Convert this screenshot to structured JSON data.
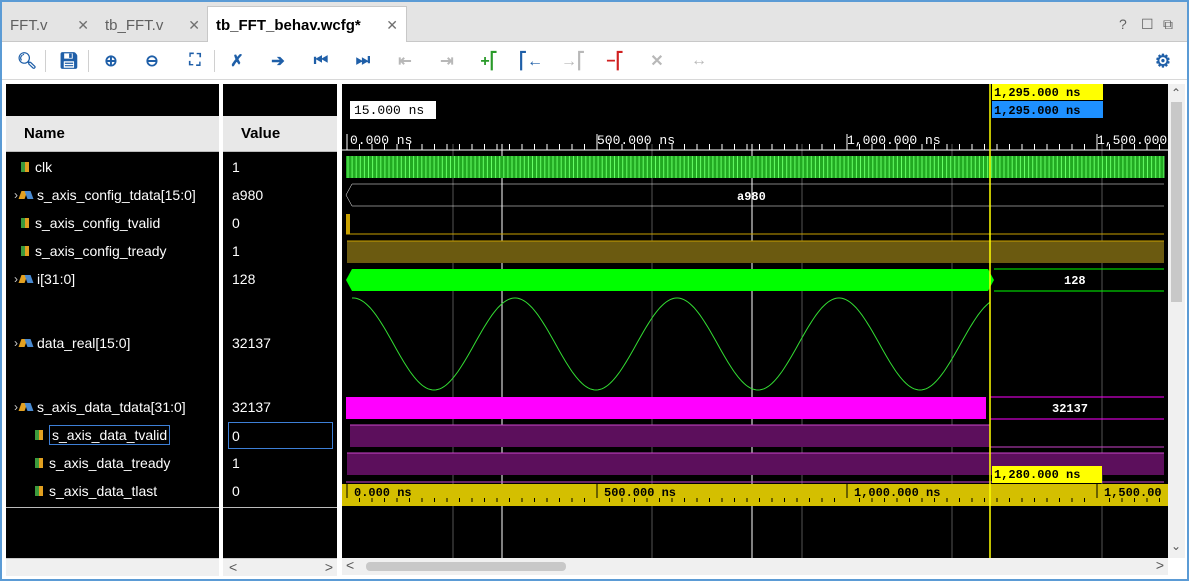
{
  "tabs": [
    {
      "label": "FFT.v",
      "active": false
    },
    {
      "label": "tb_FFT.v",
      "active": false
    },
    {
      "label": "tb_FFT_behav.wcfg*",
      "active": true
    }
  ],
  "window_controls": {
    "help": "?",
    "restore": "☐",
    "float": "⧉"
  },
  "toolbar": [
    {
      "icon": "search-icon",
      "glyph": "🔍︎"
    },
    {
      "icon": "save-icon",
      "glyph": "💾︎"
    },
    {
      "icon": "zoom-in-icon",
      "glyph": "⊕"
    },
    {
      "icon": "zoom-out-icon",
      "glyph": "⊖"
    },
    {
      "icon": "zoom-fit-icon",
      "glyph": "⛶"
    },
    {
      "icon": "cursor-snap-icon",
      "glyph": "✗"
    },
    {
      "icon": "go-to-cursor-icon",
      "glyph": "➔"
    },
    {
      "icon": "go-to-start-icon",
      "glyph": "⏮"
    },
    {
      "icon": "go-to-end-icon",
      "glyph": "⏭"
    },
    {
      "icon": "previous-transition-icon",
      "glyph": "⇤"
    },
    {
      "icon": "next-transition-icon",
      "glyph": "⇥"
    },
    {
      "icon": "add-marker-icon",
      "glyph": "+⎡"
    },
    {
      "icon": "previous-marker-icon",
      "glyph": "⎡←"
    },
    {
      "icon": "next-marker-icon",
      "glyph": "→⎡"
    },
    {
      "icon": "delete-marker-icon",
      "glyph": "−⎡"
    },
    {
      "icon": "delete-all-markers-icon",
      "glyph": "✕"
    },
    {
      "icon": "swap-cursors-icon",
      "glyph": "↔"
    }
  ],
  "settings_icon": "gear-icon",
  "columns": {
    "name": "Name",
    "value": "Value"
  },
  "signals": [
    {
      "name": "clk",
      "value": "1",
      "kind": "bit",
      "expandable": false
    },
    {
      "name": "s_axis_config_tdata[15:0]",
      "value": "a980",
      "kind": "bus",
      "expandable": true
    },
    {
      "name": "s_axis_config_tvalid",
      "value": "0",
      "kind": "bit",
      "expandable": false
    },
    {
      "name": "s_axis_config_tready",
      "value": "1",
      "kind": "bit",
      "expandable": false
    },
    {
      "name": "i[31:0]",
      "value": "128",
      "kind": "bus",
      "expandable": true
    },
    {
      "name": "data_real[15:0]",
      "value": "32137",
      "kind": "bus",
      "expandable": true
    },
    {
      "name": "s_axis_data_tdata[31:0]",
      "value": "32137",
      "kind": "bus",
      "expandable": true
    },
    {
      "name": "s_axis_data_tvalid",
      "value": "0",
      "kind": "bit",
      "expandable": false,
      "selected": true
    },
    {
      "name": "s_axis_data_tready",
      "value": "1",
      "kind": "bit",
      "expandable": false
    },
    {
      "name": "s_axis_data_tlast",
      "value": "0",
      "kind": "bit",
      "expandable": false
    }
  ],
  "timeline": {
    "top_ticks": [
      "0.000 ns",
      "500.000 ns",
      "1,000.000 ns",
      "1,500.000"
    ],
    "bottom_ticks": [
      "0.000 ns",
      "500.000 ns",
      "1,000.000 ns",
      "1,500.00"
    ],
    "cursor_time": "1,295.000 ns",
    "cursor_time_label": "1,295.000 ns",
    "delta_label": "15.000 ns",
    "marker_time": "1,280.000 ns",
    "wave_labels": {
      "config_tdata": "a980",
      "i_after": "128",
      "tdata_after": "32137"
    }
  },
  "colors": {
    "clk": "#22bb22",
    "bus_green": "#00ff00",
    "config_tready": "#6b5a10",
    "tdata": "#ff00ff",
    "tvalid": "#5c0f5c",
    "cursor": "#ffff00",
    "cursor_blue": "#1e90ff",
    "timeline_bottom": "#d4bf00"
  }
}
